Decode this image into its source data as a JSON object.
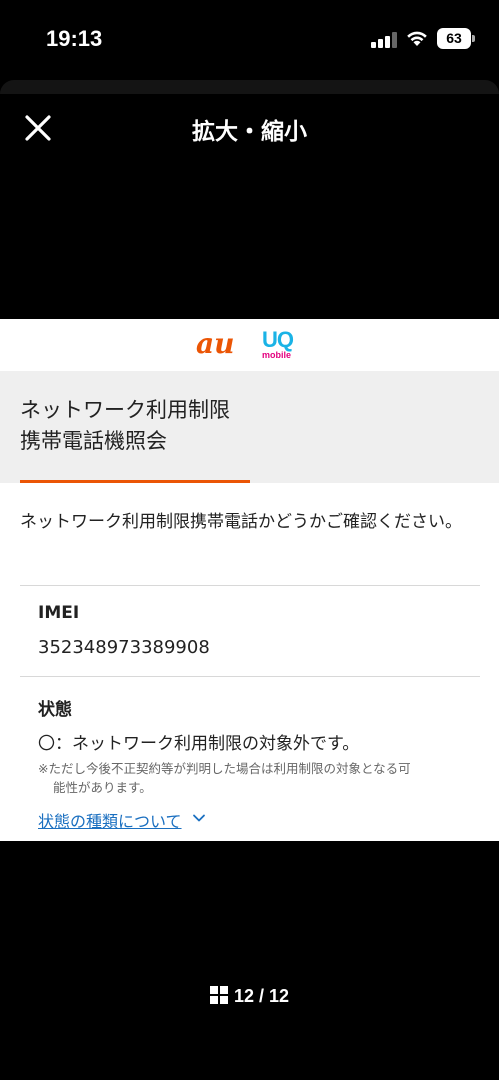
{
  "status_bar": {
    "time": "19:13",
    "battery": "63",
    "icons": [
      "signal-icon",
      "wifi-icon",
      "battery-icon"
    ]
  },
  "header": {
    "title": "拡大・縮小",
    "close_icon": "close-icon"
  },
  "document": {
    "logos": {
      "au": "au",
      "uq": "UQ",
      "uq_sub": "mobile"
    },
    "title_line1": "ネットワーク利用制限",
    "title_line2": "携帯電話機照会",
    "accent_color": "#eb5505",
    "intro": "ネットワーク利用制限携帯電話かどうかご確認ください。",
    "imei_label": "IMEI",
    "imei_value": "352348973389908",
    "status_label": "状態",
    "status_value": "〇：ネットワーク利用制限の対象外です。",
    "note_line1": "※ただし今後不正契約等が判明した場合は利用制限の対象となる可",
    "note_line2": "能性があります。",
    "status_link": "状態の種類について",
    "link_color": "#1a6fc0"
  },
  "pager": {
    "label": "12 / 12",
    "icon": "grid-icon"
  }
}
